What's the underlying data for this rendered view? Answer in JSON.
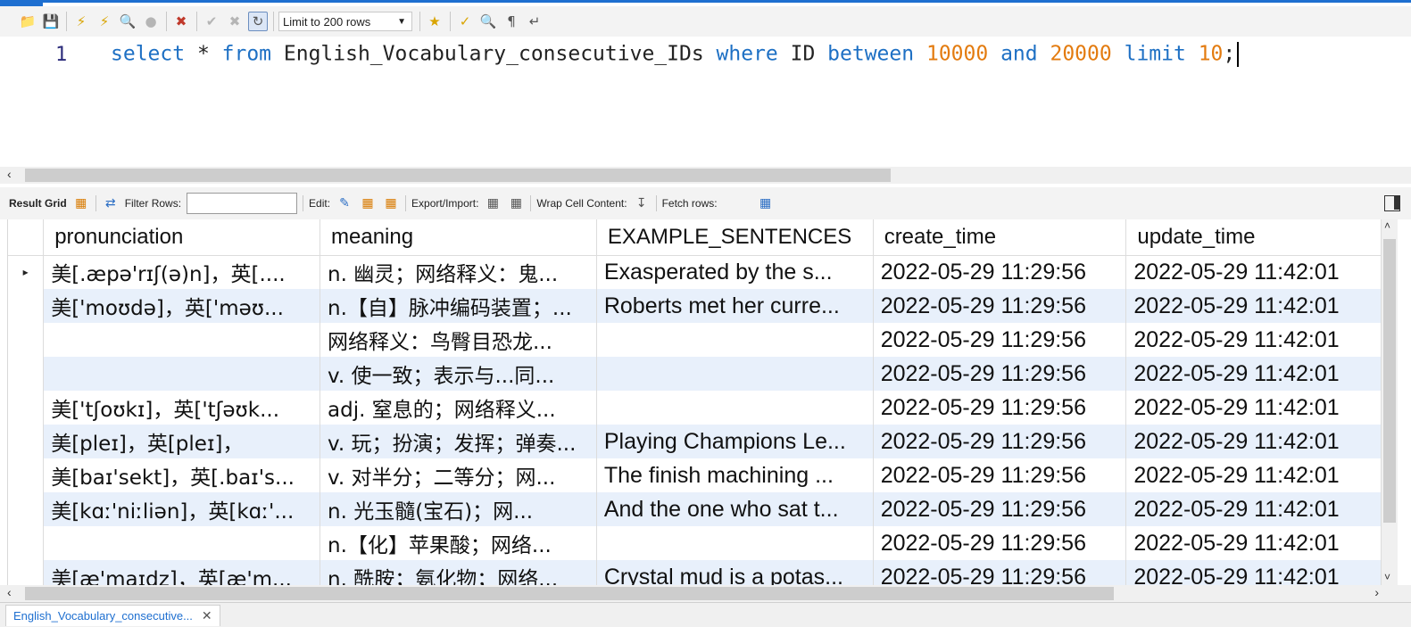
{
  "toolbar": {
    "limit_select": "Limit to 200 rows"
  },
  "editor": {
    "line_number": "1",
    "tokens": {
      "select": "select",
      "star": " * ",
      "from": "from",
      "table": " English_Vocabulary_consecutive_IDs ",
      "where": "where",
      "id": " ID ",
      "between": "between",
      "low": "10000",
      "and": "and",
      "high": "20000",
      "limit": "limit",
      "count": "10",
      "semicolon": ";"
    }
  },
  "result_toolbar": {
    "result_grid": "Result Grid",
    "filter_rows": "Filter Rows:",
    "edit": "Edit:",
    "export_import": "Export/Import:",
    "wrap_cell": "Wrap Cell Content:",
    "fetch_rows": "Fetch rows:"
  },
  "grid": {
    "columns": [
      "pronunciation",
      "meaning",
      "EXAMPLE_SENTENCES",
      "create_time",
      "update_time"
    ],
    "rows": [
      {
        "pronunciation": "美[.æpə'rɪʃ(ə)n]，英[....",
        "meaning": "n. 幽灵；网络释义：鬼...",
        "example": "Exasperated by the s...",
        "create_time": "2022-05-29 11:29:56",
        "update_time": "2022-05-29 11:42:01"
      },
      {
        "pronunciation": "美['moʊdə]，英['məʊ...",
        "meaning": "n.【自】脉冲编码装置；...",
        "example": "Roberts met her curre...",
        "create_time": "2022-05-29 11:29:56",
        "update_time": "2022-05-29 11:42:01"
      },
      {
        "pronunciation": "",
        "meaning": "网络释义：鸟臀目恐龙...",
        "example": "",
        "create_time": "2022-05-29 11:29:56",
        "update_time": "2022-05-29 11:42:01"
      },
      {
        "pronunciation": "",
        "meaning": "v. 使一致；表示与...同...",
        "example": "",
        "create_time": "2022-05-29 11:29:56",
        "update_time": "2022-05-29 11:42:01"
      },
      {
        "pronunciation": "美['tʃoʊkɪ]，英['tʃəʊk...",
        "meaning": "adj. 窒息的；网络释义...",
        "example": "",
        "create_time": "2022-05-29 11:29:56",
        "update_time": "2022-05-29 11:42:01"
      },
      {
        "pronunciation": "美[pleɪ]，英[pleɪ]，",
        "meaning": "v. 玩；扮演；发挥；弹奏...",
        "example": "Playing Champions Le...",
        "create_time": "2022-05-29 11:29:56",
        "update_time": "2022-05-29 11:42:01"
      },
      {
        "pronunciation": "美[baɪ'sekt]，英[.baɪ's...",
        "meaning": "v. 对半分；二等分；网...",
        "example": "The finish machining ...",
        "create_time": "2022-05-29 11:29:56",
        "update_time": "2022-05-29 11:42:01"
      },
      {
        "pronunciation": "美[kɑː'niːliən]，英[kɑː'...",
        "meaning": "n. 光玉髓(宝石)；网...",
        "example": "And the one who sat t...",
        "create_time": "2022-05-29 11:29:56",
        "update_time": "2022-05-29 11:42:01"
      },
      {
        "pronunciation": "",
        "meaning": "n.【化】苹果酸；网络...",
        "example": "",
        "create_time": "2022-05-29 11:29:56",
        "update_time": "2022-05-29 11:42:01"
      },
      {
        "pronunciation": "美[æ'maɪdz]，英[æ'm...",
        "meaning": "n. 酰胺；氨化物；网络...",
        "example": "Crystal mud is a potas...",
        "create_time": "2022-05-29 11:29:56",
        "update_time": "2022-05-29 11:42:01"
      }
    ]
  },
  "bottom_tab": {
    "label": "English_Vocabulary_consecutive..."
  },
  "colors": {
    "keyword": "#1e70c4",
    "number": "#e37b0f",
    "row_alt": "#e8f0fb",
    "accent": "#1e6fd0"
  },
  "icons": [
    "folder-icon",
    "save-icon",
    "execute-icon",
    "execute-current-icon",
    "explain-icon",
    "stop-icon",
    "toggle-error-icon",
    "commit-icon",
    "rollback-icon",
    "autocommit-icon",
    "bookmark-icon",
    "beautify-icon",
    "find-icon",
    "invisible-chars-icon",
    "wrap-icon"
  ]
}
